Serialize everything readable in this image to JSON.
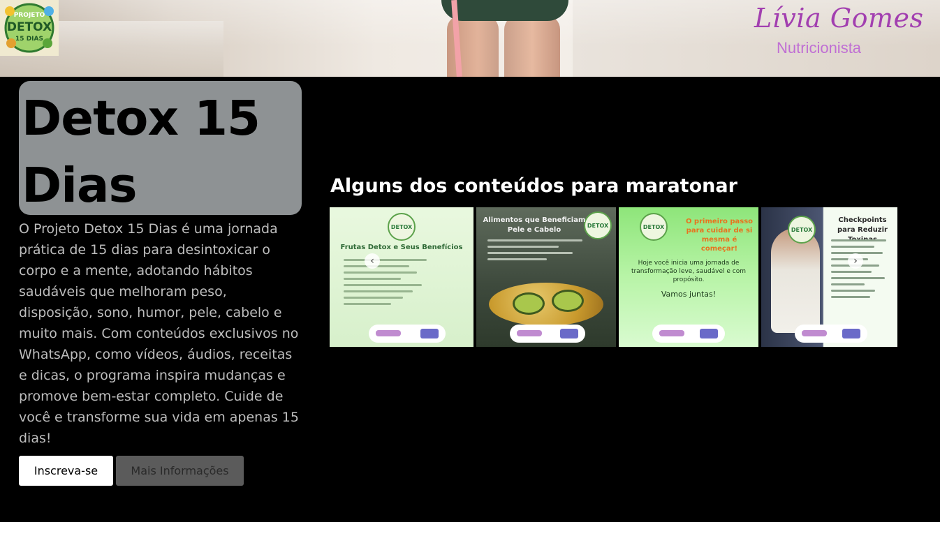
{
  "header": {
    "logo": {
      "icon": "detox-logo-icon",
      "text_top": "PROJETO",
      "text_main": "DETOX",
      "text_bottom": "15 DIAS"
    },
    "brand_name": "Lívia Gomes",
    "brand_role": "Nutricionista"
  },
  "hero": {
    "title": "Detox 15 Dias",
    "description": "O Projeto Detox 15 Dias é uma jornada prática de 15 dias para desintoxicar o corpo e a mente, adotando hábitos saudáveis que melhoram peso, disposição, sono, humor, pele, cabelo e muito mais. Com conteúdos exclusivos no WhatsApp, como vídeos, áudios, receitas e dicas, o programa inspira mudanças e promove bem-estar completo. Cuide de você e transforme sua vida em apenas 15 dias!",
    "primary_button": "Inscreva-se",
    "secondary_button": "Mais Informações"
  },
  "carousel": {
    "title": "Alguns dos conteúdos para maratonar",
    "prev_icon": "‹",
    "next_icon": "›",
    "cards": [
      {
        "heading": "Frutas Detox e Seus Benefícios"
      },
      {
        "heading": "Alimentos que Beneficiam Pele e Cabelo"
      },
      {
        "heading": "O primeiro passo para cuidar de si mesma é começar!",
        "body": "Hoje você inicia uma jornada de transformação leve, saudável e com propósito.",
        "cta": "Vamos juntas!"
      },
      {
        "heading": "Checkpoints para Reduzir Toxinas"
      }
    ]
  },
  "colors": {
    "brand_purple": "#a23fb0",
    "main_bg": "#000000",
    "title_box": "#8e9294"
  }
}
